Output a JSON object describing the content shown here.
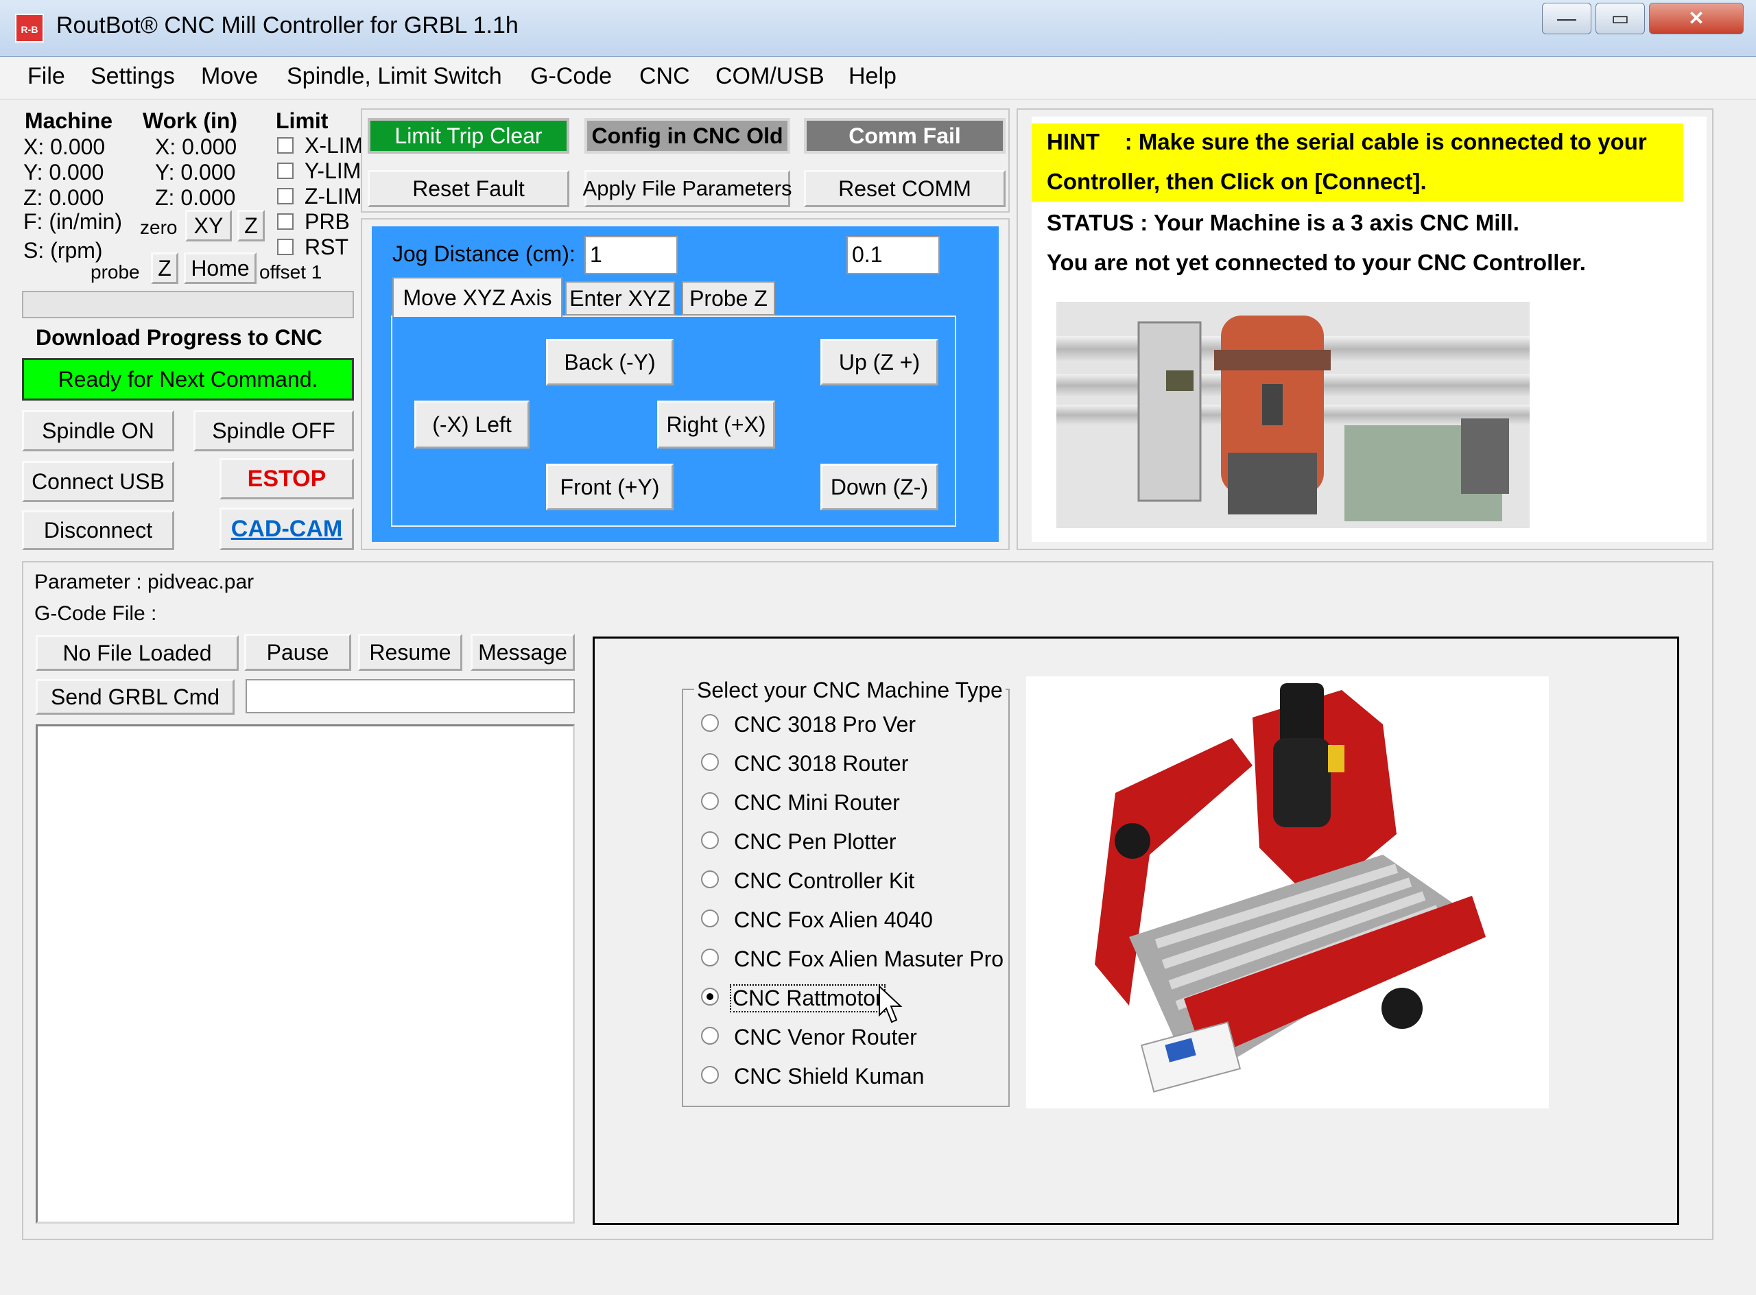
{
  "window": {
    "title": "RoutBot® CNC Mill Controller for GRBL 1.1h",
    "logo_text": "R-B",
    "minimize_glyph": "—",
    "maximize_glyph": "▭",
    "close_glyph": "✕"
  },
  "menu": [
    "File",
    "Settings",
    "Move",
    "Spindle, Limit Switch",
    "G-Code",
    "CNC",
    "COM/USB",
    "Help"
  ],
  "position": {
    "machine_header": "Machine",
    "work_header": "Work (in)",
    "limit_header": "Limit",
    "machine": [
      "X: 0.000",
      "Y: 0.000",
      "Z: 0.000"
    ],
    "work": [
      "X: 0.000",
      "Y: 0.000",
      "Z: 0.000"
    ],
    "feed_label": "F: (in/min)",
    "speed_label": "S: (rpm)",
    "zero_label": "zero",
    "zero_xy": "XY",
    "zero_z": "Z",
    "probe_label": "probe",
    "probe_z": "Z",
    "home": "Home",
    "offset_label": "offset 1",
    "limits": [
      "X-LIM",
      "Y-LIM",
      "Z-LIM",
      "PRB",
      "RST"
    ]
  },
  "progress": {
    "label": "Download Progress to CNC",
    "status": "Ready for Next Command.",
    "value": 0
  },
  "controls": {
    "spindle_on": "Spindle ON",
    "spindle_off": "Spindle OFF",
    "connect_usb": "Connect USB",
    "estop": "ESTOP",
    "disconnect": "Disconnect",
    "cad_cam": "CAD-CAM"
  },
  "status_buttons": {
    "limit_trip_clear": "Limit Trip Clear",
    "config_cnc_old": "Config in CNC Old",
    "comm_fail": "Comm Fail",
    "reset_fault": "Reset Fault",
    "apply_file_params": "Apply File Parameters",
    "reset_comm": "Reset COMM"
  },
  "jog": {
    "distance_label": "Jog Distance (cm):",
    "distance_value": "1",
    "step_value": "0.1",
    "tabs": [
      "Move XYZ Axis",
      "Enter XYZ",
      "Probe Z"
    ],
    "back": "Back  (-Y)",
    "up": "Up (Z +)",
    "left": "(-X) Left",
    "right": "Right  (+X)",
    "front": "Front  (+Y)",
    "down": "Down (Z-)"
  },
  "hint": {
    "line1": "HINT    : Make sure the serial cable is connected to your",
    "line2": "Controller, then Click on [Connect].",
    "status1": "STATUS : Your Machine is a 3 axis CNC Mill.",
    "status2": "You are not yet connected to your CNC Controller."
  },
  "file": {
    "parameter": "Parameter : pidveac.par",
    "gcode": "G-Code File :",
    "no_file": "No File Loaded",
    "pause": "Pause",
    "resume": "Resume",
    "message": "Message",
    "send_cmd": "Send GRBL Cmd",
    "cmd_value": ""
  },
  "machine_type": {
    "legend": "Select your CNC Machine Type",
    "options": [
      "CNC 3018 Pro Ver",
      "CNC 3018 Router",
      "CNC Mini Router",
      "CNC Pen Plotter",
      "CNC Controller Kit",
      "CNC Fox Alien 4040",
      "CNC Fox Alien Masuter Pro",
      "CNC Rattmotor",
      "CNC Venor Router",
      "CNC Shield Kuman"
    ],
    "selected_index": 7
  },
  "colors": {
    "ready_green": "#00ff00",
    "limit_green": "#0a9a2a",
    "jog_blue": "#3399ff",
    "hint_yellow": "#ffff00",
    "estop_red": "#e00000",
    "cadcam_blue": "#0066cc"
  }
}
